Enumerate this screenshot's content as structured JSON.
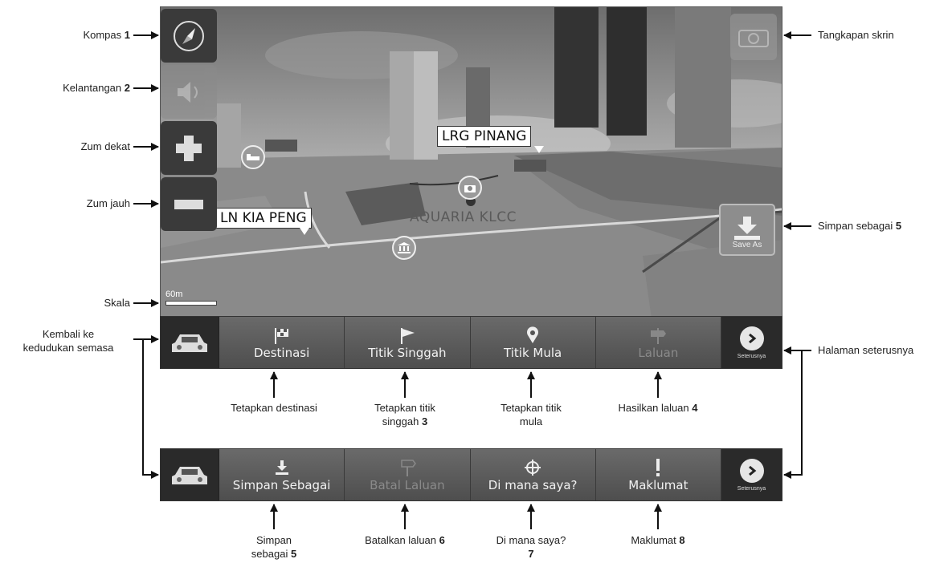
{
  "map": {
    "street_labels": [
      "LRG PINANG",
      "LN KIA PENG"
    ],
    "place_label": "AQUARIA KLCC",
    "scale": "60m",
    "save_as_label": "Save As"
  },
  "toolbar1": {
    "buttons": [
      "Destinasi",
      "Titik Singgah",
      "Titik Mula",
      "Laluan"
    ],
    "next_label": "Seterusnya"
  },
  "toolbar2": {
    "buttons": [
      "Simpan Sebagai",
      "Batal Laluan",
      "Di mana saya?",
      "Maklumat"
    ],
    "next_label": "Seterusnya"
  },
  "callouts": {
    "kompas": "Kompas",
    "kompas_n": "1",
    "kelantangan": "Kelantangan",
    "kelantangan_n": "2",
    "zum_dekat": "Zum dekat",
    "zum_jauh": "Zum jauh",
    "skala": "Skala",
    "kembali_1": "Kembali ke",
    "kembali_2": "kedudukan semasa",
    "tangkapan": "Tangkapan skrin",
    "simpan_sebagai_r": "Simpan sebagai",
    "simpan_sebagai_r_n": "5",
    "halaman": "Halaman seterusnya",
    "tetapkan_destinasi": "Tetapkan destinasi",
    "titik_singgah_1": "Tetapkan titik",
    "titik_singgah_2": "singgah",
    "titik_singgah_n": "3",
    "titik_mula_1": "Tetapkan titik",
    "titik_mula_2": "mula",
    "hasilkan": "Hasilkan laluan",
    "hasilkan_n": "4",
    "simpan_b_1": "Simpan",
    "simpan_b_2": "sebagai",
    "simpan_b_n": "5",
    "batalkan": "Batalkan laluan",
    "batalkan_n": "6",
    "di_mana_1": "Di mana saya?",
    "di_mana_n": "7",
    "maklumat": "Maklumat",
    "maklumat_n": "8"
  }
}
